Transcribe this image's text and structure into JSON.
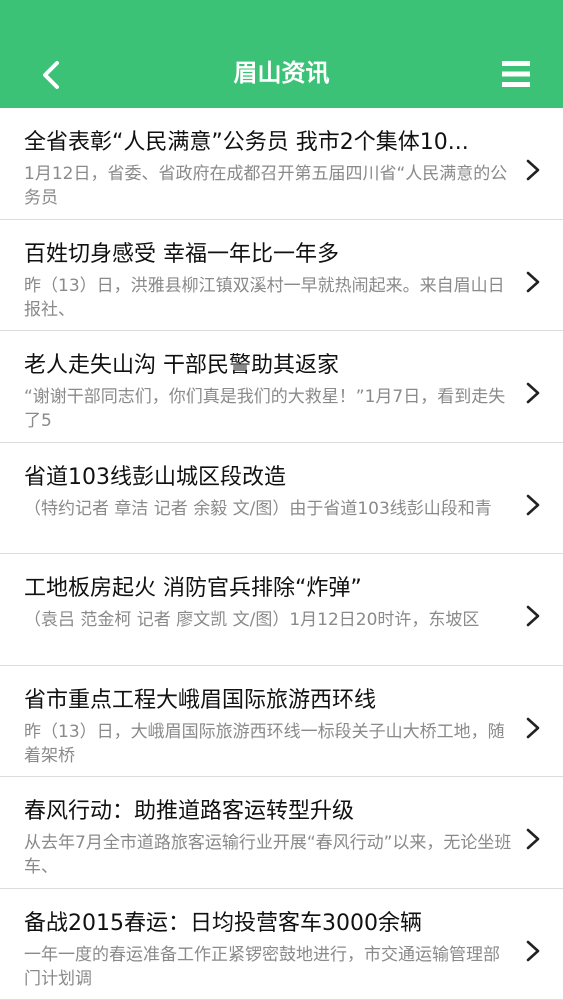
{
  "header": {
    "title": "眉山资讯",
    "back_icon": "chevron-left-icon",
    "menu_icon": "hamburger-menu-icon",
    "background_color": "#3cc276"
  },
  "news": [
    {
      "title": "全省表彰“人民满意”公务员 我市2个集体10...",
      "summary": "1月12日，省委、省政府在成都召开第五届四川省“人民满意的公务员"
    },
    {
      "title": "百姓切身感受 幸福一年比一年多",
      "summary": "昨（13）日，洪雅县柳江镇双溪村一早就热闹起来。来自眉山日报社、"
    },
    {
      "title": "老人走失山沟 干部民警助其返家",
      "summary": "“谢谢干部同志们，你们真是我们的大救星！”1月7日，看到走失了5"
    },
    {
      "title": "省道103线彭山城区段改造",
      "summary": "（特约记者 章洁 记者 余毅 文/图）由于省道103线彭山段和青"
    },
    {
      "title": "工地板房起火 消防官兵排除“炸弹”",
      "summary": "（袁吕 范金柯 记者 廖文凯 文/图）1月12日20时许，东坡区"
    },
    {
      "title": "省市重点工程大峨眉国际旅游西环线",
      "summary": "昨（13）日，大峨眉国际旅游西环线一标段关子山大桥工地，随着架桥"
    },
    {
      "title": "春风行动：助推道路客运转型升级",
      "summary": "从去年7月全市道路旅客运输行业开展“春风行动”以来，无论坐班车、"
    },
    {
      "title": "备战2015春运：日均投营客车3000余辆",
      "summary": "一年一度的春运准备工作正紧锣密鼓地进行，市交通运输管理部门计划调"
    }
  ]
}
